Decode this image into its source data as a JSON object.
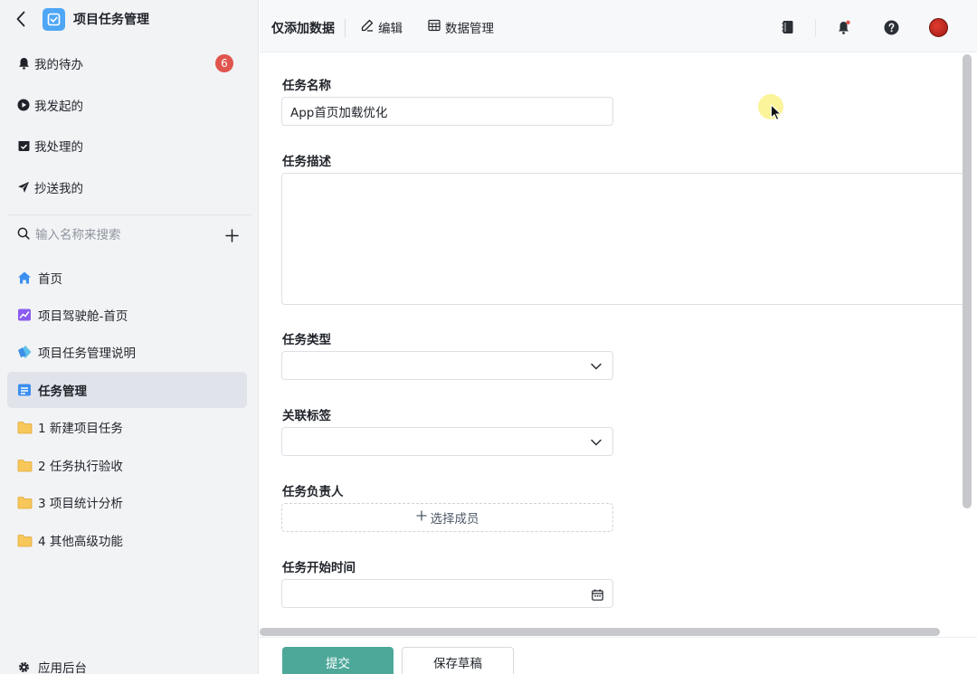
{
  "app": {
    "title": "项目任务管理",
    "accent_color": "#4ea6f5"
  },
  "sidebar": {
    "todo_items": [
      {
        "label": "我的待办",
        "icon": "bell-icon",
        "badge": "6"
      },
      {
        "label": "我发起的",
        "icon": "play-circle-icon"
      },
      {
        "label": "我处理的",
        "icon": "inbox-check-icon"
      },
      {
        "label": "抄送我的",
        "icon": "paper-plane-icon"
      }
    ],
    "search": {
      "placeholder": "输入名称来搜索"
    },
    "nav_items": [
      {
        "label": "首页",
        "icon": "home-icon"
      },
      {
        "label": "项目驾驶舱-首页",
        "icon": "dashboard-chart-icon"
      },
      {
        "label": "项目任务管理说明",
        "icon": "help-doc-icon"
      },
      {
        "label": "任务管理",
        "icon": "form-icon",
        "active": true
      },
      {
        "label": "1 新建项目任务",
        "icon": "folder-icon"
      },
      {
        "label": "2 任务执行验收",
        "icon": "folder-icon"
      },
      {
        "label": "3 项目统计分析",
        "icon": "folder-icon"
      },
      {
        "label": "4 其他高级功能",
        "icon": "folder-icon"
      }
    ],
    "settings": {
      "label": "应用后台",
      "icon": "gear-icon"
    }
  },
  "toolbar": {
    "page_title": "仅添加数据",
    "edit_label": "编辑",
    "data_manage_label": "数据管理"
  },
  "form": {
    "task_name": {
      "label": "任务名称",
      "value": "App首页加载优化"
    },
    "task_desc": {
      "label": "任务描述",
      "value": ""
    },
    "task_type": {
      "label": "任务类型",
      "value": ""
    },
    "tags": {
      "label": "关联标签",
      "value": ""
    },
    "owner": {
      "label": "任务负责人",
      "button_label": "选择成员"
    },
    "start_time": {
      "label": "任务开始时间",
      "value": ""
    }
  },
  "footer": {
    "submit_label": "提交",
    "draft_label": "保存草稿",
    "submit_color": "#4da89a"
  }
}
